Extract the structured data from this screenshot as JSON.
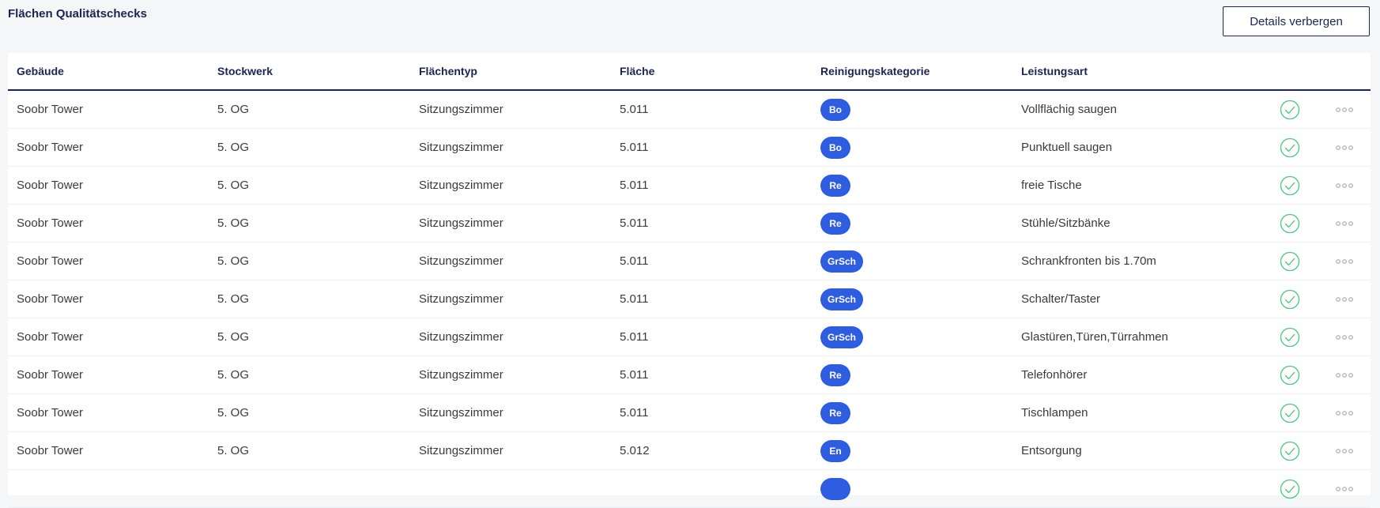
{
  "page": {
    "title": "Flächen Qualitätschecks",
    "details_button_label": "Details verbergen"
  },
  "colors": {
    "primary_navy": "#1b2550",
    "badge_blue": "#2f5de0",
    "check_green": "#4cc77d",
    "more_grey": "#9aa0a6"
  },
  "icons": {
    "status": "check-circle-icon",
    "actions": "more-horizontal-icon"
  },
  "table": {
    "columns": [
      "Gebäude",
      "Stockwerk",
      "Flächentyp",
      "Fläche",
      "Reinigungskategorie",
      "Leistungsart"
    ],
    "rows": [
      {
        "gebaeude": "Soobr Tower",
        "stockwerk": "5. OG",
        "flaechentyp": "Sitzungszimmer",
        "flaeche": "5.011",
        "kategorie": "Bo",
        "leistungsart": "Vollflächig saugen"
      },
      {
        "gebaeude": "Soobr Tower",
        "stockwerk": "5. OG",
        "flaechentyp": "Sitzungszimmer",
        "flaeche": "5.011",
        "kategorie": "Bo",
        "leistungsart": "Punktuell saugen"
      },
      {
        "gebaeude": "Soobr Tower",
        "stockwerk": "5. OG",
        "flaechentyp": "Sitzungszimmer",
        "flaeche": "5.011",
        "kategorie": "Re",
        "leistungsart": "freie Tische"
      },
      {
        "gebaeude": "Soobr Tower",
        "stockwerk": "5. OG",
        "flaechentyp": "Sitzungszimmer",
        "flaeche": "5.011",
        "kategorie": "Re",
        "leistungsart": "Stühle/Sitzbänke"
      },
      {
        "gebaeude": "Soobr Tower",
        "stockwerk": "5. OG",
        "flaechentyp": "Sitzungszimmer",
        "flaeche": "5.011",
        "kategorie": "GrSch",
        "leistungsart": "Schrankfronten bis 1.70m"
      },
      {
        "gebaeude": "Soobr Tower",
        "stockwerk": "5. OG",
        "flaechentyp": "Sitzungszimmer",
        "flaeche": "5.011",
        "kategorie": "GrSch",
        "leistungsart": "Schalter/Taster"
      },
      {
        "gebaeude": "Soobr Tower",
        "stockwerk": "5. OG",
        "flaechentyp": "Sitzungszimmer",
        "flaeche": "5.011",
        "kategorie": "GrSch",
        "leistungsart": "Glastüren,Türen,Türrahmen"
      },
      {
        "gebaeude": "Soobr Tower",
        "stockwerk": "5. OG",
        "flaechentyp": "Sitzungszimmer",
        "flaeche": "5.011",
        "kategorie": "Re",
        "leistungsart": "Telefonhörer"
      },
      {
        "gebaeude": "Soobr Tower",
        "stockwerk": "5. OG",
        "flaechentyp": "Sitzungszimmer",
        "flaeche": "5.011",
        "kategorie": "Re",
        "leistungsart": "Tischlampen"
      },
      {
        "gebaeude": "Soobr Tower",
        "stockwerk": "5. OG",
        "flaechentyp": "Sitzungszimmer",
        "flaeche": "5.012",
        "kategorie": "En",
        "leistungsart": "Entsorgung"
      },
      {
        "gebaeude": "",
        "stockwerk": "",
        "flaechentyp": "",
        "flaeche": "",
        "kategorie": "",
        "leistungsart": ""
      }
    ]
  }
}
